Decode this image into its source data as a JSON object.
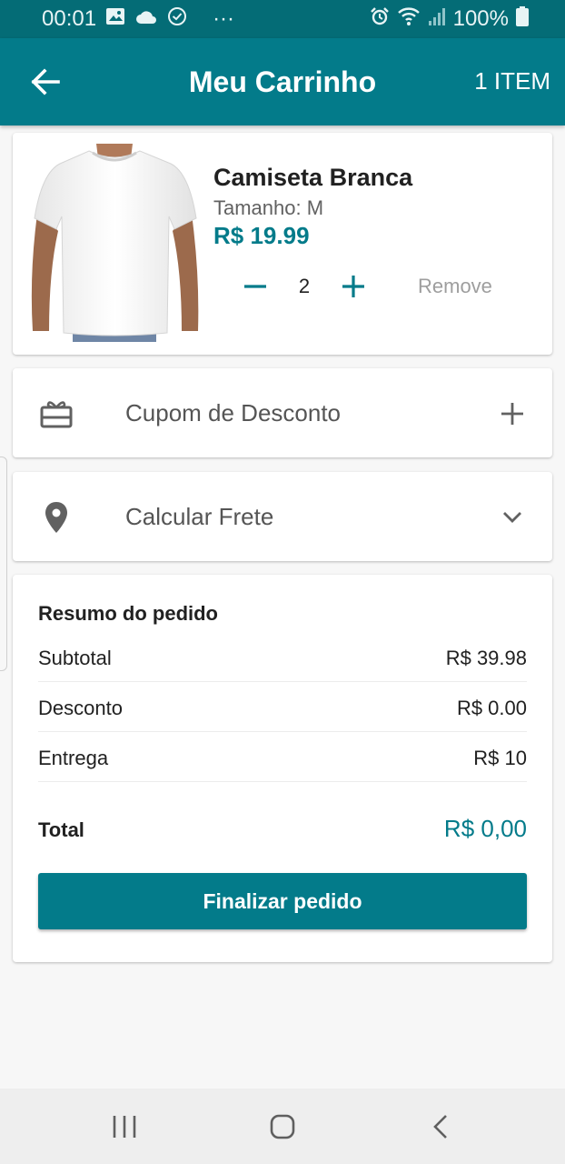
{
  "status_bar": {
    "time": "00:01",
    "more": "···",
    "battery": "100%",
    "icons": [
      "image-icon",
      "cloud-icon",
      "check-circle-icon",
      "alarm-icon",
      "wifi-icon",
      "signal-icon",
      "battery-icon"
    ]
  },
  "app_bar": {
    "title": "Meu Carrinho",
    "item_count": "1 ITEM",
    "back_icon": "arrow-left-icon"
  },
  "cart": {
    "items": [
      {
        "name": "Camiseta Branca",
        "size": "Tamanho: M",
        "price": "R$ 19.99",
        "quantity": "2",
        "remove_label": "Remove",
        "image": "white-tshirt-photo"
      }
    ]
  },
  "coupon": {
    "label": "Cupom de Desconto",
    "icon": "gift-card-icon",
    "action_icon": "plus-icon"
  },
  "shipping": {
    "label": "Calcular Frete",
    "icon": "location-pin-icon",
    "action_icon": "chevron-down-icon"
  },
  "summary": {
    "title": "Resumo do pedido",
    "rows": [
      {
        "label": "Subtotal",
        "value": "R$ 39.98"
      },
      {
        "label": "Desconto",
        "value": "R$ 0.00"
      },
      {
        "label": "Entrega",
        "value": "R$ 10"
      }
    ],
    "total_label": "Total",
    "total_value": "R$ 0,00",
    "checkout_label": "Finalizar pedido"
  },
  "colors": {
    "primary": "#037b8a",
    "status_bar": "#046c76",
    "muted_text": "#9e9e9e"
  }
}
